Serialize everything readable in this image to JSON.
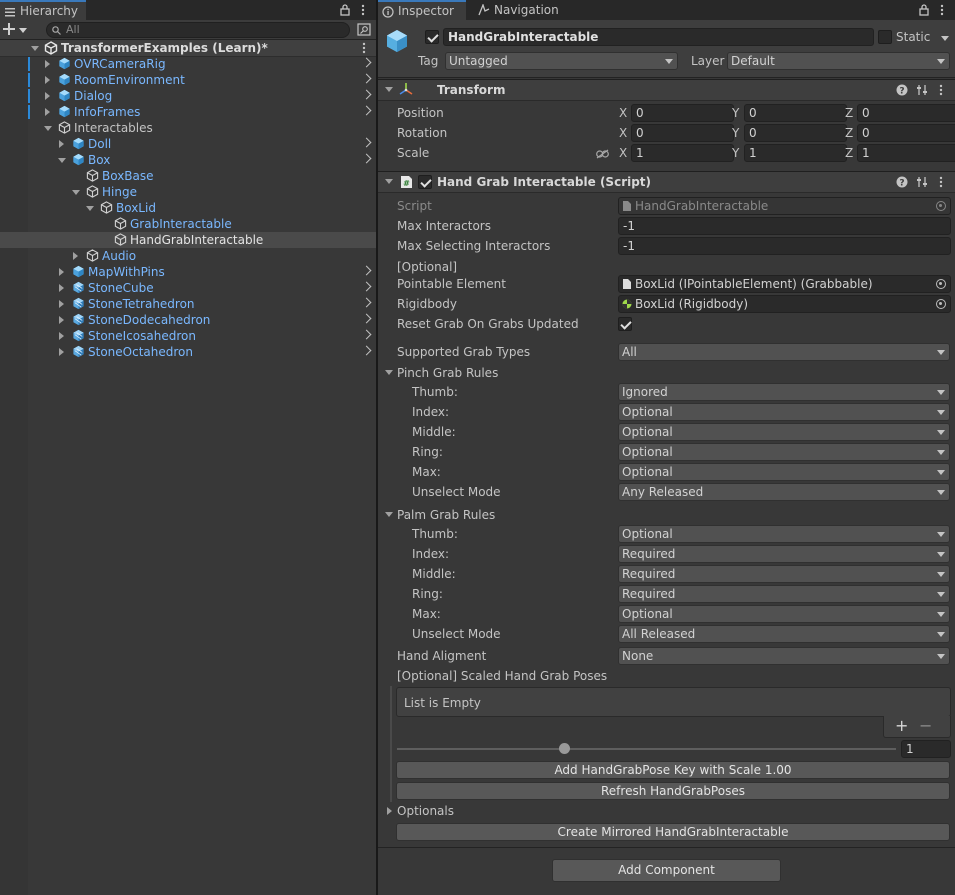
{
  "hierarchy": {
    "tab_label": "Hierarchy",
    "search_placeholder": "All",
    "scene_name": "TransformerExamples (Learn)*",
    "items": [
      {
        "label": "OVRCameraRig"
      },
      {
        "label": "RoomEnvironment"
      },
      {
        "label": "Dialog"
      },
      {
        "label": "InfoFrames"
      },
      {
        "label": "Interactables"
      },
      {
        "label": "Doll"
      },
      {
        "label": "Box"
      },
      {
        "label": "BoxBase"
      },
      {
        "label": "Hinge"
      },
      {
        "label": "BoxLid"
      },
      {
        "label": "GrabInteractable"
      },
      {
        "label": "HandGrabInteractable"
      },
      {
        "label": "Audio"
      },
      {
        "label": "MapWithPins"
      },
      {
        "label": "StoneCube"
      },
      {
        "label": "StoneTetrahedron"
      },
      {
        "label": "StoneDodecahedron"
      },
      {
        "label": "StoneIcosahedron"
      },
      {
        "label": "StoneOctahedron"
      }
    ]
  },
  "inspector": {
    "tab_label": "Inspector",
    "nav_tab_label": "Navigation",
    "object_name": "HandGrabInteractable",
    "static_label": "Static",
    "tag_label": "Tag",
    "tag_value": "Untagged",
    "layer_label": "Layer",
    "layer_value": "Default",
    "transform": {
      "title": "Transform",
      "position_label": "Position",
      "rotation_label": "Rotation",
      "scale_label": "Scale",
      "x": "X",
      "y": "Y",
      "z": "Z",
      "position": [
        "0",
        "0",
        "0"
      ],
      "rotation": [
        "0",
        "0",
        "0"
      ],
      "scale": [
        "1",
        "1",
        "1"
      ]
    },
    "script_comp": {
      "title": "Hand Grab Interactable (Script)",
      "script_label": "Script",
      "script_value": "HandGrabInteractable",
      "max_interactors_label": "Max Interactors",
      "max_interactors": "-1",
      "max_selecting_label": "Max Selecting Interactors",
      "max_selecting": "-1",
      "optional_header": "[Optional]",
      "pointable_label": "Pointable Element",
      "pointable_value": "BoxLid (IPointableElement) (Grabbable)",
      "rigidbody_label": "Rigidbody",
      "rigidbody_value": "BoxLid (Rigidbody)",
      "reset_label": "Reset Grab On Grabs Updated",
      "supported_label": "Supported Grab Types",
      "supported_value": "All",
      "pinch_header": "Pinch Grab Rules",
      "palm_header": "Palm Grab Rules",
      "rule_labels": [
        "Thumb:",
        "Index:",
        "Middle:",
        "Ring:",
        "Max:",
        "Unselect Mode"
      ],
      "pinch_values": [
        "Ignored",
        "Optional",
        "Optional",
        "Optional",
        "Optional",
        "Any Released"
      ],
      "palm_values": [
        "Optional",
        "Required",
        "Required",
        "Required",
        "Optional",
        "All Released"
      ],
      "hand_align_label": "Hand Aligment",
      "hand_align_value": "None",
      "scaled_label": "[Optional] Scaled Hand Grab Poses",
      "list_empty": "List is Empty",
      "plus": "+",
      "minus": "−",
      "slider_value": "1",
      "add_key_button": "Add HandGrabPose Key with Scale 1.00",
      "refresh_button": "Refresh HandGrabPoses",
      "optionals_label": "Optionals",
      "mirrored_button": "Create Mirrored HandGrabInteractable"
    },
    "add_component": "Add Component"
  }
}
